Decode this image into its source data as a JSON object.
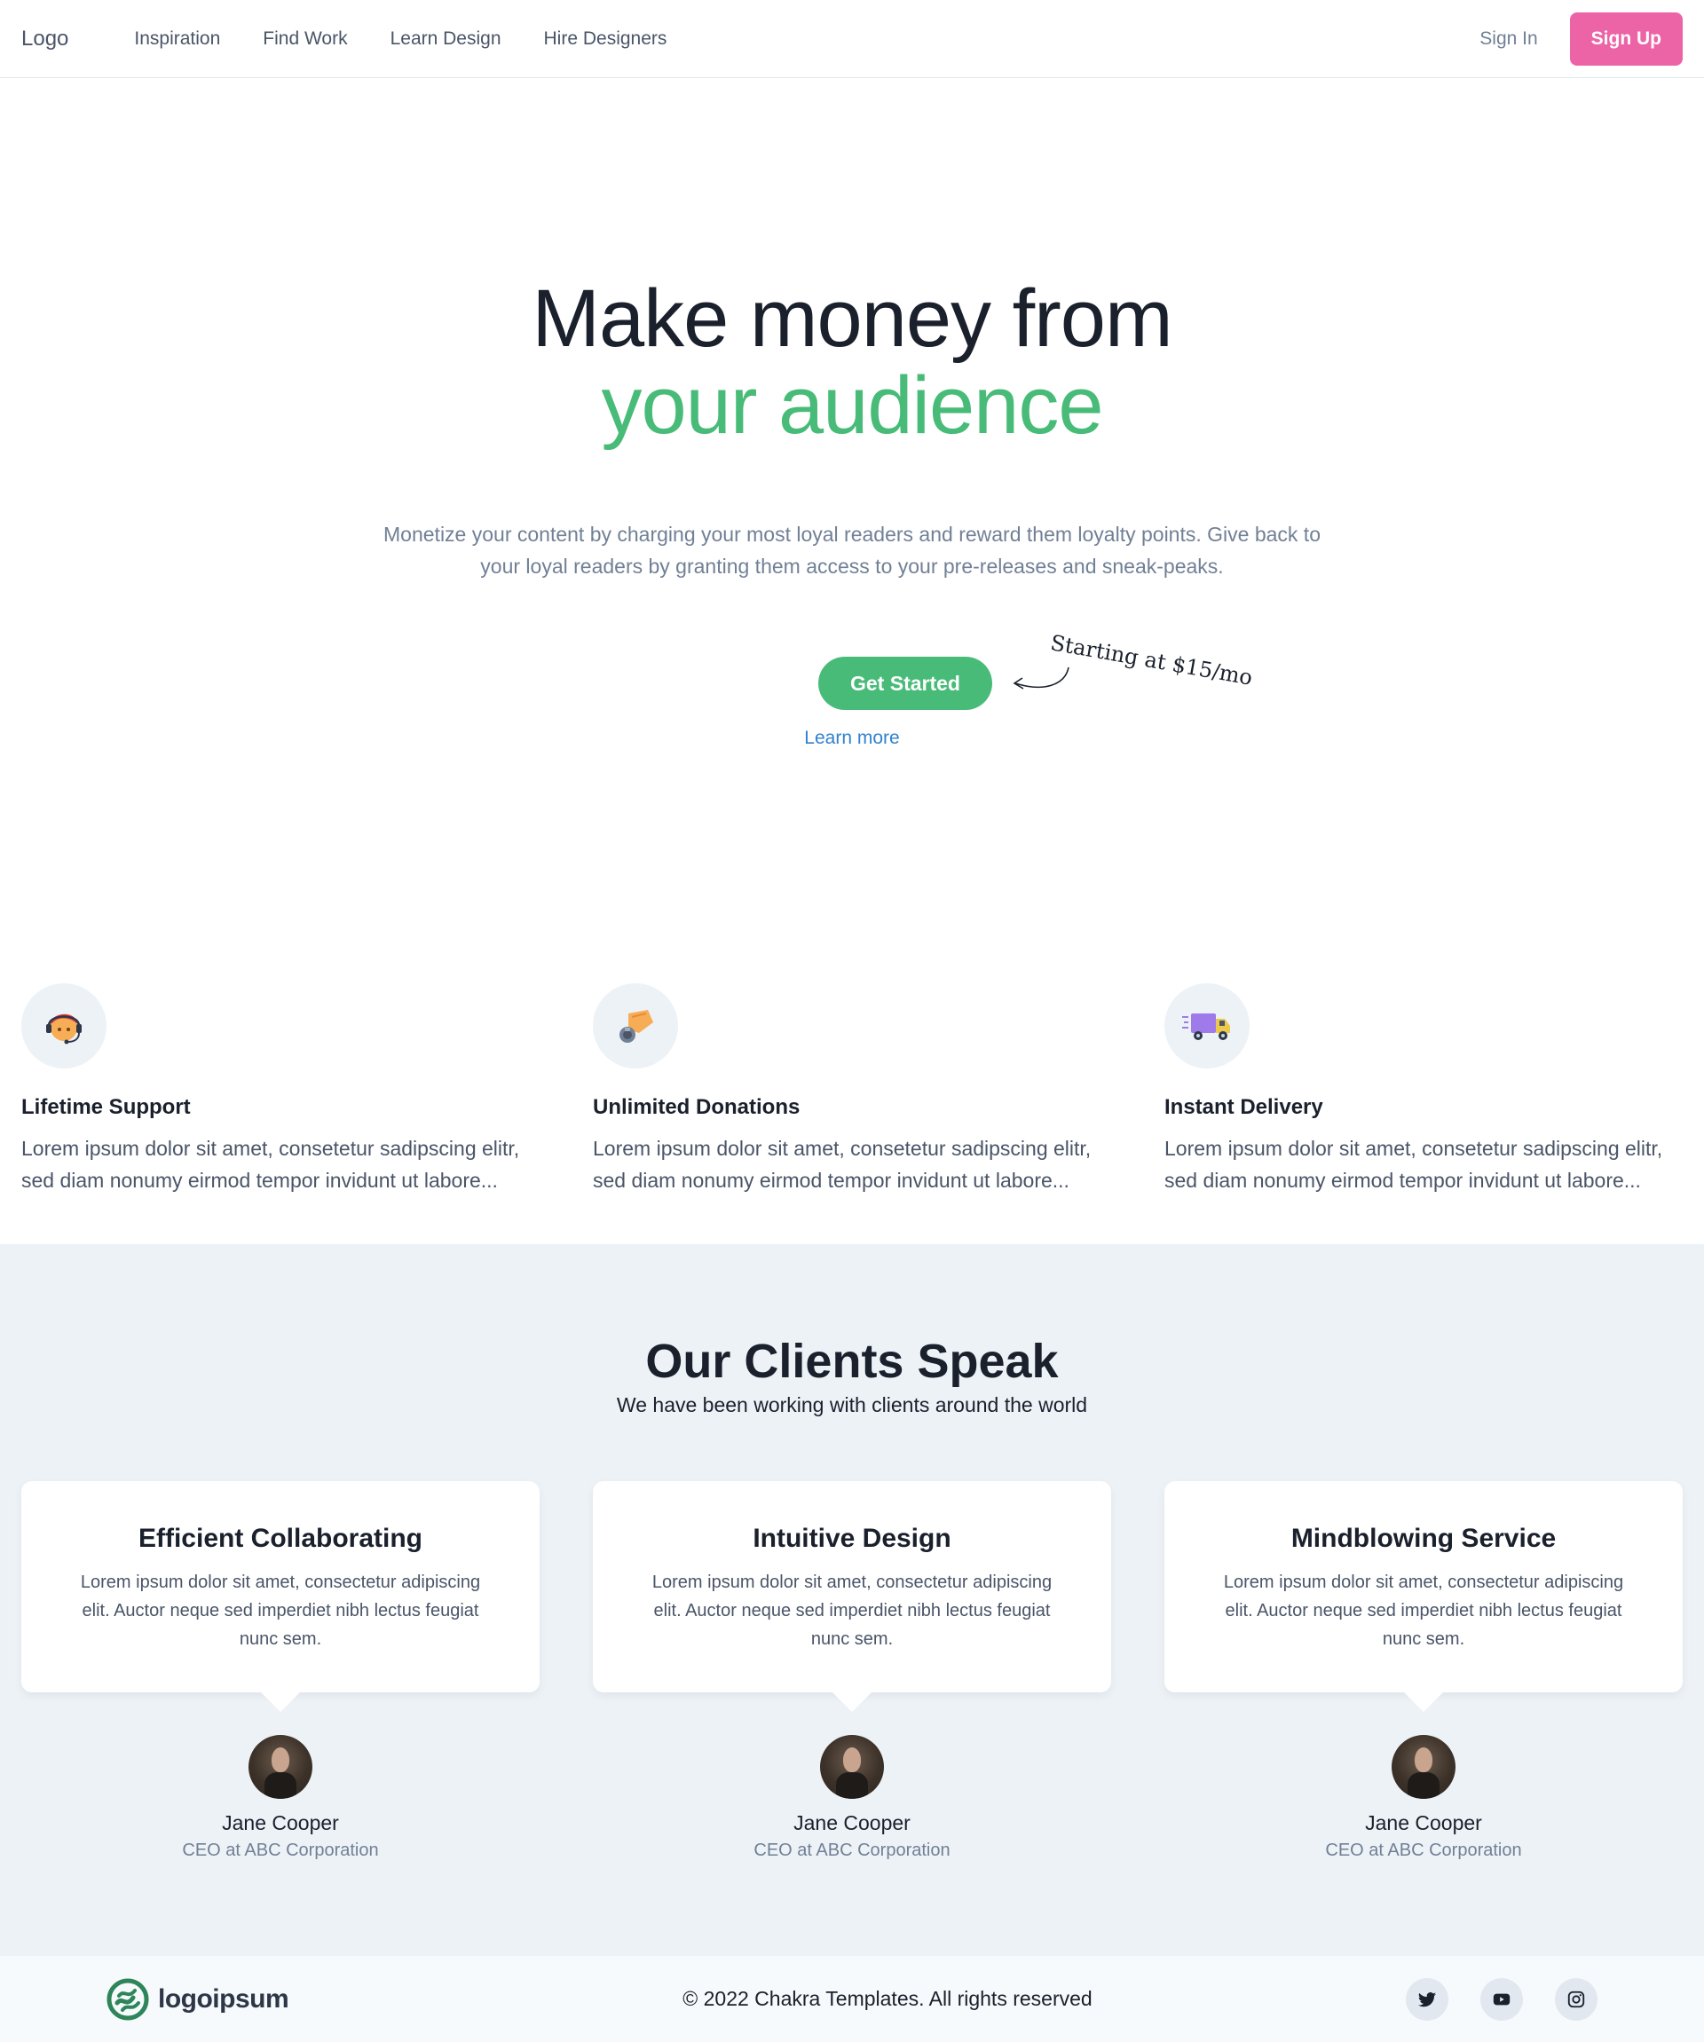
{
  "nav": {
    "logo": "Logo",
    "links": [
      "Inspiration",
      "Find Work",
      "Learn Design",
      "Hire Designers"
    ],
    "sign_in": "Sign In",
    "sign_up": "Sign Up"
  },
  "hero": {
    "title_line1": "Make money from",
    "title_line2": "your audience",
    "description": "Monetize your content by charging your most loyal readers and reward them loyalty points. Give back to your loyal readers by granting them access to your pre-releases and sneak-peaks.",
    "cta": "Get Started",
    "learn_more": "Learn more",
    "starting_note": "Starting at $15/mo"
  },
  "features": [
    {
      "icon": "support-agent-icon",
      "title": "Lifetime Support",
      "text": "Lorem ipsum dolor sit amet, consetetur sadipscing elitr, sed diam nonumy eirmod tempor invidunt ut labore..."
    },
    {
      "icon": "donation-hand-icon",
      "title": "Unlimited Donations",
      "text": "Lorem ipsum dolor sit amet, consetetur sadipscing elitr, sed diam nonumy eirmod tempor invidunt ut labore..."
    },
    {
      "icon": "delivery-truck-icon",
      "title": "Instant Delivery",
      "text": "Lorem ipsum dolor sit amet, consetetur sadipscing elitr, sed diam nonumy eirmod tempor invidunt ut labore..."
    }
  ],
  "clients": {
    "heading": "Our Clients Speak",
    "subheading": "We have been working with clients around the world",
    "testimonials": [
      {
        "title": "Efficient Collaborating",
        "text": "Lorem ipsum dolor sit amet, consectetur adipiscing elit. Auctor neque sed imperdiet nibh lectus feugiat nunc sem.",
        "name": "Jane Cooper",
        "role": "CEO at ABC Corporation"
      },
      {
        "title": "Intuitive Design",
        "text": "Lorem ipsum dolor sit amet, consectetur adipiscing elit. Auctor neque sed imperdiet nibh lectus feugiat nunc sem.",
        "name": "Jane Cooper",
        "role": "CEO at ABC Corporation"
      },
      {
        "title": "Mindblowing Service",
        "text": "Lorem ipsum dolor sit amet, consectetur adipiscing elit. Auctor neque sed imperdiet nibh lectus feugiat nunc sem.",
        "name": "Jane Cooper",
        "role": "CEO at ABC Corporation"
      }
    ]
  },
  "footer": {
    "brand": "logoipsum",
    "copyright": "© 2022 Chakra Templates. All rights reserved",
    "social": [
      "twitter-icon",
      "youtube-icon",
      "instagram-icon"
    ]
  },
  "colors": {
    "accent_green": "#48bb78",
    "accent_pink": "#ed64a6",
    "link_blue": "#3182ce"
  }
}
